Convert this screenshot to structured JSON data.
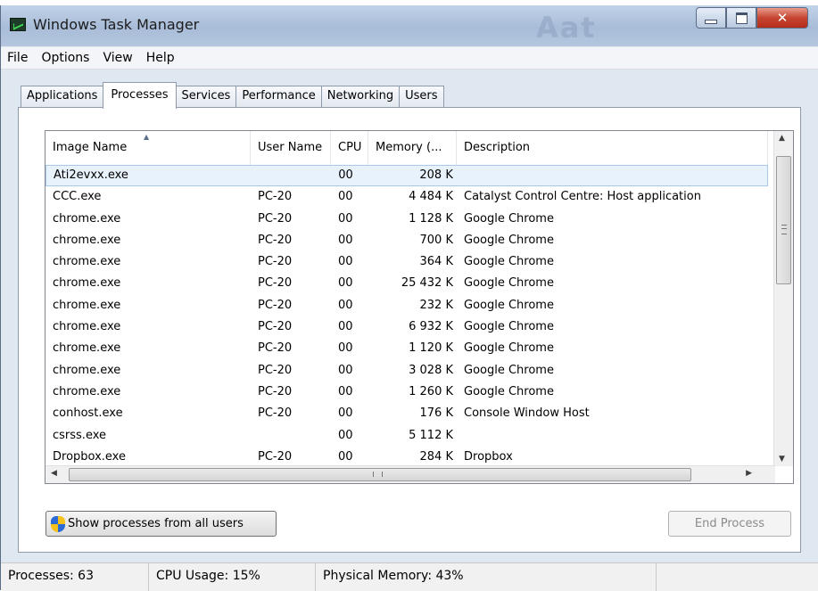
{
  "window": {
    "title": "Windows Task Manager",
    "title_ghost": "Aat"
  },
  "menu": [
    "File",
    "Options",
    "View",
    "Help"
  ],
  "tabs": [
    "Applications",
    "Processes",
    "Services",
    "Performance",
    "Networking",
    "Users"
  ],
  "active_tab": "Processes",
  "columns": [
    "Image Name",
    "User Name",
    "CPU",
    "Memory (...",
    "Description"
  ],
  "sorted_column": "Image Name",
  "processes": [
    {
      "name": "Ati2evxx.exe",
      "user": "",
      "cpu": "00",
      "mem": "208 K",
      "desc": "",
      "selected": true
    },
    {
      "name": "CCC.exe",
      "user": "PC-20",
      "cpu": "00",
      "mem": "4 484 K",
      "desc": "Catalyst Control Centre: Host application"
    },
    {
      "name": "chrome.exe",
      "user": "PC-20",
      "cpu": "00",
      "mem": "1 128 K",
      "desc": "Google Chrome"
    },
    {
      "name": "chrome.exe",
      "user": "PC-20",
      "cpu": "00",
      "mem": "700 K",
      "desc": "Google Chrome"
    },
    {
      "name": "chrome.exe",
      "user": "PC-20",
      "cpu": "00",
      "mem": "364 K",
      "desc": "Google Chrome"
    },
    {
      "name": "chrome.exe",
      "user": "PC-20",
      "cpu": "00",
      "mem": "25 432 K",
      "desc": "Google Chrome"
    },
    {
      "name": "chrome.exe",
      "user": "PC-20",
      "cpu": "00",
      "mem": "232 K",
      "desc": "Google Chrome"
    },
    {
      "name": "chrome.exe",
      "user": "PC-20",
      "cpu": "00",
      "mem": "6 932 K",
      "desc": "Google Chrome"
    },
    {
      "name": "chrome.exe",
      "user": "PC-20",
      "cpu": "00",
      "mem": "1 120 K",
      "desc": "Google Chrome"
    },
    {
      "name": "chrome.exe",
      "user": "PC-20",
      "cpu": "00",
      "mem": "3 028 K",
      "desc": "Google Chrome"
    },
    {
      "name": "chrome.exe",
      "user": "PC-20",
      "cpu": "00",
      "mem": "1 260 K",
      "desc": "Google Chrome"
    },
    {
      "name": "conhost.exe",
      "user": "PC-20",
      "cpu": "00",
      "mem": "176 K",
      "desc": "Console Window Host"
    },
    {
      "name": "csrss.exe",
      "user": "",
      "cpu": "00",
      "mem": "5 112 K",
      "desc": ""
    },
    {
      "name": "Dropbox.exe",
      "user": "PC-20",
      "cpu": "00",
      "mem": "284 K",
      "desc": "Dropbox"
    }
  ],
  "buttons": {
    "show_all": "Show processes from all users",
    "end_process": "End Process"
  },
  "status": {
    "processes": "Processes: 63",
    "cpu": "CPU Usage: 15%",
    "memory": "Physical Memory: 43%"
  },
  "colors": {
    "title_bar": "#b5c7df",
    "close_button": "#c54531",
    "selection": "#e8f2fc"
  },
  "icons": {
    "app": "task-manager-icon",
    "minimize": "minimize-icon",
    "maximize": "maximize-icon",
    "close": "close-icon",
    "uac": "shield-icon"
  }
}
